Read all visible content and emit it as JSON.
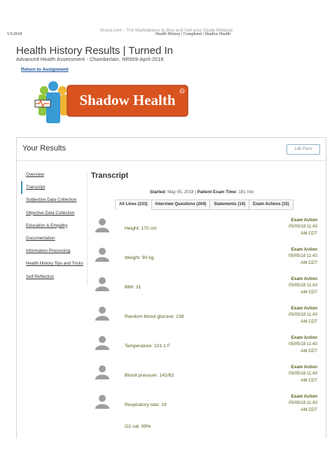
{
  "print_header": {
    "watermark": "Stuvia.com - The Marketplace to Buy and Sell your Study Material",
    "date": "5/5/2018",
    "title": "Health History | Completed | Shadow Health"
  },
  "page": {
    "title": "Health History Results | Turned In",
    "subtitle": "Advanced Health Assessment - Chamberlain, NR509-April-2018",
    "return_link": "Return to Assignment",
    "logo_text": "Shadow Health"
  },
  "results": {
    "title": "Your Results",
    "lab_button": "Lab Pass"
  },
  "sidebar": {
    "items": [
      {
        "label": "Overview",
        "active": false
      },
      {
        "label": "Transcript",
        "active": true
      },
      {
        "label": "Subjective Data Collection",
        "active": false
      },
      {
        "label": "Objective Data Collection",
        "active": false
      },
      {
        "label": "Education & Empathy",
        "active": false
      },
      {
        "label": "Documentation",
        "active": false
      },
      {
        "label": "Information Processing",
        "active": false
      },
      {
        "label": "Health History Tips and Tricks",
        "active": false
      },
      {
        "label": "Self-Reflection",
        "active": false
      }
    ]
  },
  "transcript": {
    "title": "Transcript",
    "started_label": "Started:",
    "started_value": "May 05, 2018",
    "separator": "|",
    "exam_time_label": "Patient Exam Time:",
    "exam_time_value": "181 min",
    "tabs": [
      {
        "label": "All Lines (233)",
        "active": true
      },
      {
        "label": "Interview Questions (204)",
        "active": false
      },
      {
        "label": "Statements (14)",
        "active": false
      },
      {
        "label": "Exam Actions (15)",
        "active": false
      }
    ],
    "entries": [
      {
        "finding": "Height: 170 cm",
        "label": "Exam Action",
        "date": "05/05/18  11:43",
        "time": "AM CDT"
      },
      {
        "finding": "Weight: 90 kg",
        "label": "Exam Action",
        "date": "05/05/18  11:43",
        "time": "AM CDT"
      },
      {
        "finding": "BMI: 31",
        "label": "Exam Action",
        "date": "05/05/18  11:43",
        "time": "AM CDT"
      },
      {
        "finding": "Random blood glucose: 238",
        "label": "Exam Action",
        "date": "05/05/18  11:43",
        "time": "AM CDT"
      },
      {
        "finding": "Temperature: 101.1 F",
        "label": "Exam Action",
        "date": "05/05/18  11:43",
        "time": "AM CDT"
      },
      {
        "finding": "Blood pressure: 142/82",
        "label": "Exam Action",
        "date": "05/05/18  11:43",
        "time": "AM CDT"
      },
      {
        "finding": "Respiratory rate: 19",
        "label": "Exam Action",
        "date": "05/05/18  11:43",
        "time": "AM CDT"
      },
      {
        "finding": "O2 sat: 99%"
      }
    ]
  },
  "colors": {
    "finding_text": "#5c5c1c",
    "link": "#1a4f9a",
    "logo_orange": "#d9531e",
    "active_accent": "#3e8fb8"
  }
}
